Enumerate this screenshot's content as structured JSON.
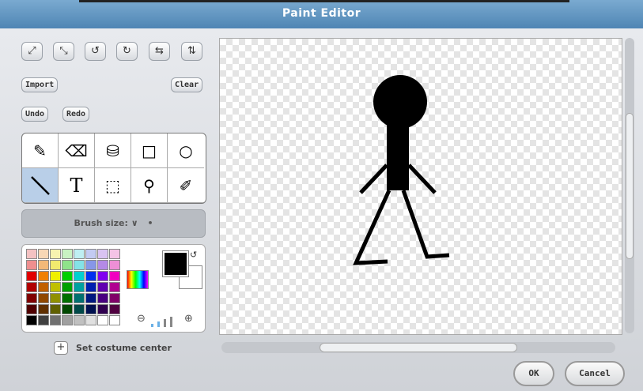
{
  "window": {
    "title": "Paint Editor"
  },
  "toolbar": {
    "transform_icons": [
      "grow-icon",
      "shrink-icon",
      "rotate-left-icon",
      "rotate-right-icon",
      "flip-horizontal-icon",
      "flip-vertical-icon"
    ],
    "transform_glyphs": [
      "⤢",
      "⤡",
      "↺",
      "↻",
      "⇆",
      "⇅"
    ],
    "import_label": "Import",
    "clear_label": "Clear",
    "undo_label": "Undo",
    "redo_label": "Redo"
  },
  "tools": {
    "names": [
      "paintbrush-icon",
      "eraser-icon",
      "fill-bucket-icon",
      "rectangle-icon",
      "ellipse-icon",
      "line-icon",
      "text-icon",
      "select-icon",
      "stamp-icon",
      "eyedropper-icon"
    ],
    "glyphs": [
      "✎",
      "⌫",
      "⛁",
      "□",
      "○",
      "",
      "T",
      "⬚",
      "⚲",
      "✐"
    ],
    "selected": "line-icon"
  },
  "brush": {
    "label": "Brush size:",
    "chevron": "∨",
    "dot": "•"
  },
  "palette": {
    "colors": [
      "#f4c2c2",
      "#f7d7b5",
      "#f7f3b0",
      "#c8f2c2",
      "#bfeff2",
      "#c3cbf3",
      "#d9c3f2",
      "#f4c3e6",
      "#ef8f8f",
      "#f3b978",
      "#f2ea6e",
      "#8fe38a",
      "#84e2e7",
      "#8797e8",
      "#b48ae6",
      "#ee8fd6",
      "#e00000",
      "#f08000",
      "#f0f000",
      "#00d000",
      "#00d0d0",
      "#0030f0",
      "#8000f0",
      "#f000c0",
      "#b00000",
      "#c06000",
      "#c0c000",
      "#00a000",
      "#00a0a0",
      "#0020b0",
      "#6000b0",
      "#b00090",
      "#800000",
      "#904800",
      "#909000",
      "#007000",
      "#007070",
      "#001880",
      "#480080",
      "#800068",
      "#500000",
      "#603000",
      "#606000",
      "#004800",
      "#004848",
      "#001050",
      "#300050",
      "#500040",
      "#000000",
      "#404040",
      "#707070",
      "#a0a0a0",
      "#c0c0c0",
      "#e0e0e0",
      "#ffffff",
      "#ffffff"
    ],
    "foreground": "#000000",
    "background": "#ffffff"
  },
  "costume_center": {
    "label": "Set costume center",
    "icon": "+"
  },
  "dialog": {
    "ok_label": "OK",
    "cancel_label": "Cancel"
  }
}
